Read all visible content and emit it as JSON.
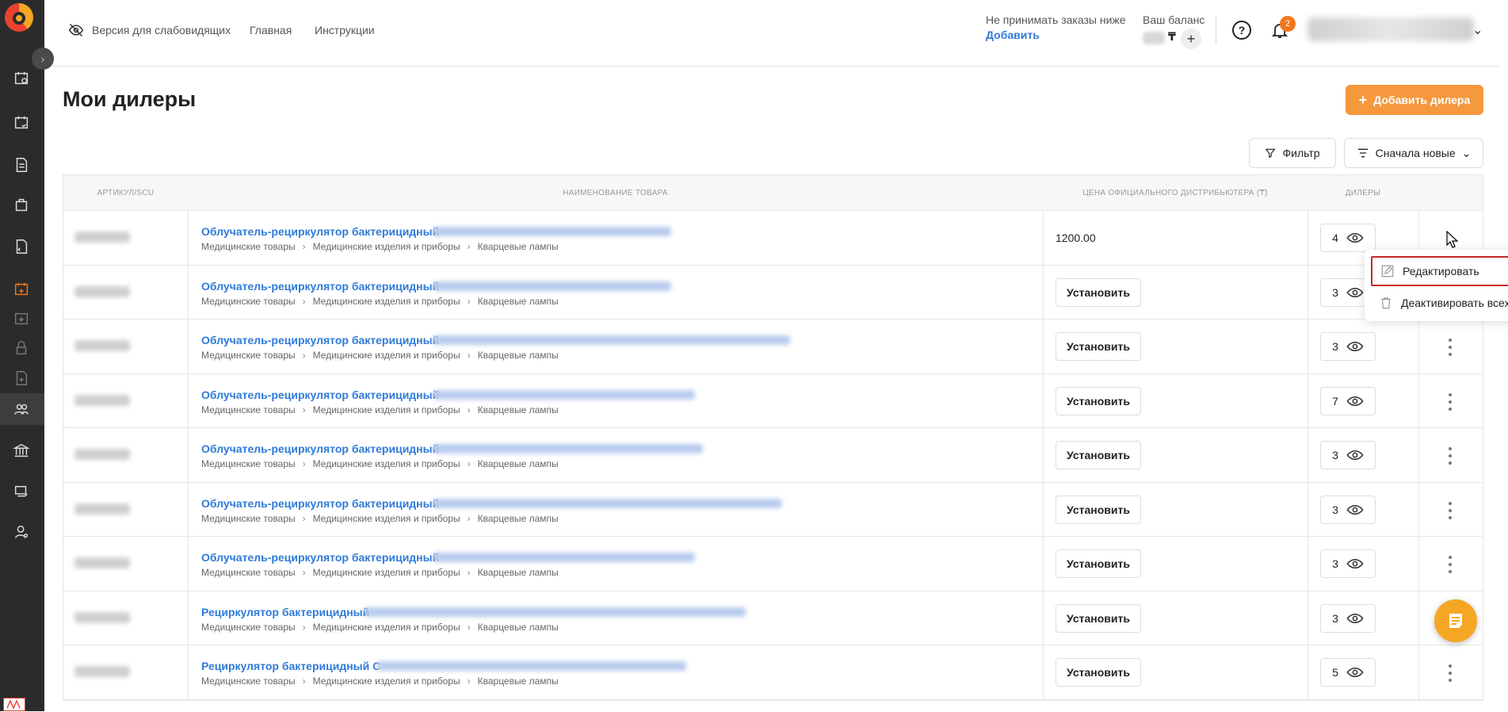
{
  "header": {
    "accessibility_label": "Версия для слабовидящих",
    "nav_home": "Главная",
    "nav_instructions": "Инструкции",
    "orders_text": "Не принимать заказы ниже",
    "orders_link": "Добавить",
    "balance_label": "Ваш баланс",
    "balance_currency": "₸",
    "notifications_count": "2"
  },
  "page": {
    "title": "Мои дилеры",
    "add_dealer_label": "Добавить дилера",
    "filter_label": "Фильтр",
    "sort_label": "Сначала новые"
  },
  "table": {
    "columns": [
      "АРТИКУЛ/SCU",
      "НАИМЕНОВАНИЕ ТОВАРА",
      "ЦЕНА ОФИЦИАЛЬНОГО ДИСТРИБЬЮТЕРА (₸)",
      "ДИЛЕРЫ"
    ],
    "set_label": "Установить",
    "crumbs": [
      "Медицинские товары",
      "Медицинские изделия и приборы",
      "Кварцевые лампы"
    ],
    "rows": [
      {
        "title": "Облучатель-рециркулятор бактерицидный",
        "price": "1200.00",
        "dealers": "4"
      },
      {
        "title": "Облучатель-рециркулятор бактерицидный",
        "price": "",
        "dealers": "3"
      },
      {
        "title": "Облучатель-рециркулятор бактерицидный",
        "price": "",
        "dealers": "3"
      },
      {
        "title": "Облучатель-рециркулятор бактерицидный",
        "price": "",
        "dealers": "7"
      },
      {
        "title": "Облучатель-рециркулятор бактерицидный",
        "price": "",
        "dealers": "3"
      },
      {
        "title": "Облучатель-рециркулятор бактерицидный",
        "price": "",
        "dealers": "3"
      },
      {
        "title": "Облучатель-рециркулятор бактерицидный",
        "price": "",
        "dealers": "3"
      },
      {
        "title": "Рециркулятор бактерицидный",
        "price": "",
        "dealers": "3"
      },
      {
        "title": "Рециркулятор бактерицидный С",
        "price": "",
        "dealers": "5"
      }
    ]
  },
  "menu": {
    "edit_label": "Редактировать",
    "deactivate_label": "Деактивировать всех"
  }
}
